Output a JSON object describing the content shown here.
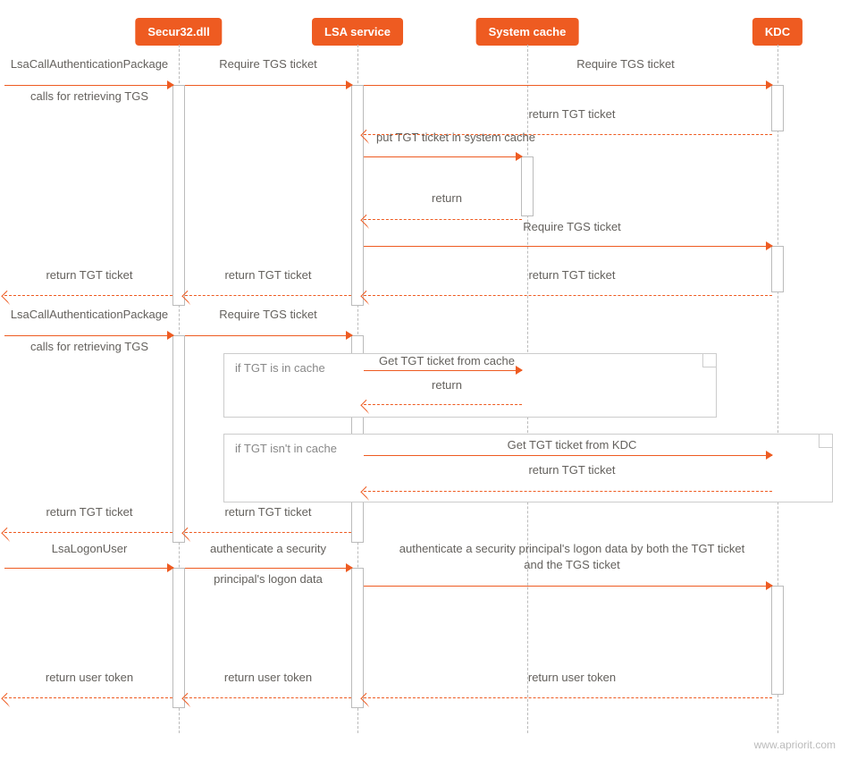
{
  "participants": {
    "p1": "Secur32.dll",
    "p2": "LSA service",
    "p3": "System cache",
    "p4": "KDC"
  },
  "labels": {
    "caller1_a": "LsaCallAuthenticationPackage",
    "caller1_b": "calls for retrieving TGS",
    "m1": "Require TGS ticket",
    "m2": "Require TGS ticket",
    "m3": "return TGT ticket",
    "m4": "put TGT ticket in system cache",
    "m5": "return",
    "m6": "Require TGS ticket",
    "m7": "return TGT ticket",
    "m7b": "return TGT ticket",
    "m7c": "return TGT ticket",
    "caller2_a": "LsaCallAuthenticationPackage",
    "caller2_b": "calls for retrieving TGS",
    "m8": "Require TGS ticket",
    "note1": "if TGT is in cache",
    "m9": "Get TGT ticket from cache",
    "m10": "return",
    "note2": "if TGT isn't in cache",
    "m11": "Get TGT ticket from KDC",
    "m12": "return TGT ticket",
    "m13": "return TGT ticket",
    "m13b": "return TGT ticket",
    "caller3": "LsaLogonUser",
    "m14a": "authenticate a security",
    "m14b": "principal's logon data",
    "m15a": "authenticate a security principal's logon data by both the TGT ticket",
    "m15b": "and the TGS ticket",
    "m16": "return user token",
    "m16b": "return user token",
    "m16c": "return user token"
  },
  "watermark": "www.apriorit.com",
  "chart_data": {
    "type": "sequence-diagram",
    "participants": [
      "Secur32.dll",
      "LSA service",
      "System cache",
      "KDC"
    ],
    "external_actor": "caller",
    "messages": [
      {
        "from": "caller",
        "to": "Secur32.dll",
        "text": "LsaCallAuthenticationPackage calls for retrieving TGS",
        "style": "solid"
      },
      {
        "from": "Secur32.dll",
        "to": "LSA service",
        "text": "Require TGS ticket",
        "style": "solid"
      },
      {
        "from": "LSA service",
        "to": "KDC",
        "text": "Require TGS ticket",
        "style": "solid"
      },
      {
        "from": "KDC",
        "to": "LSA service",
        "text": "return TGT ticket",
        "style": "dashed"
      },
      {
        "from": "LSA service",
        "to": "System cache",
        "text": "put TGT ticket in system cache",
        "style": "solid"
      },
      {
        "from": "System cache",
        "to": "LSA service",
        "text": "return",
        "style": "dashed"
      },
      {
        "from": "LSA service",
        "to": "KDC",
        "text": "Require TGS ticket",
        "style": "solid"
      },
      {
        "from": "KDC",
        "to": "LSA service",
        "text": "return TGT ticket",
        "style": "dashed"
      },
      {
        "from": "LSA service",
        "to": "Secur32.dll",
        "text": "return TGT ticket",
        "style": "dashed"
      },
      {
        "from": "Secur32.dll",
        "to": "caller",
        "text": "return TGT ticket",
        "style": "dashed"
      },
      {
        "from": "caller",
        "to": "Secur32.dll",
        "text": "LsaCallAuthenticationPackage calls for retrieving TGS",
        "style": "solid"
      },
      {
        "from": "Secur32.dll",
        "to": "LSA service",
        "text": "Require TGS ticket",
        "style": "solid"
      },
      {
        "alt": "if TGT is in cache",
        "messages": [
          {
            "from": "LSA service",
            "to": "System cache",
            "text": "Get TGT ticket from cache",
            "style": "solid"
          },
          {
            "from": "System cache",
            "to": "LSA service",
            "text": "return",
            "style": "dashed"
          }
        ]
      },
      {
        "alt": "if TGT isn't in cache",
        "messages": [
          {
            "from": "LSA service",
            "to": "KDC",
            "text": "Get TGT ticket from KDC",
            "style": "solid"
          },
          {
            "from": "KDC",
            "to": "LSA service",
            "text": "return TGT ticket",
            "style": "dashed"
          }
        ]
      },
      {
        "from": "LSA service",
        "to": "Secur32.dll",
        "text": "return TGT ticket",
        "style": "dashed"
      },
      {
        "from": "Secur32.dll",
        "to": "caller",
        "text": "return TGT ticket",
        "style": "dashed"
      },
      {
        "from": "caller",
        "to": "Secur32.dll",
        "text": "LsaLogonUser",
        "style": "solid"
      },
      {
        "from": "Secur32.dll",
        "to": "LSA service",
        "text": "authenticate a security principal's logon data",
        "style": "solid"
      },
      {
        "from": "LSA service",
        "to": "KDC",
        "text": "authenticate a security principal's logon data by both the TGT ticket and the TGS ticket",
        "style": "solid"
      },
      {
        "from": "KDC",
        "to": "LSA service",
        "text": "return user token",
        "style": "dashed"
      },
      {
        "from": "LSA service",
        "to": "Secur32.dll",
        "text": "return user token",
        "style": "dashed"
      },
      {
        "from": "Secur32.dll",
        "to": "caller",
        "text": "return user token",
        "style": "dashed"
      }
    ]
  }
}
